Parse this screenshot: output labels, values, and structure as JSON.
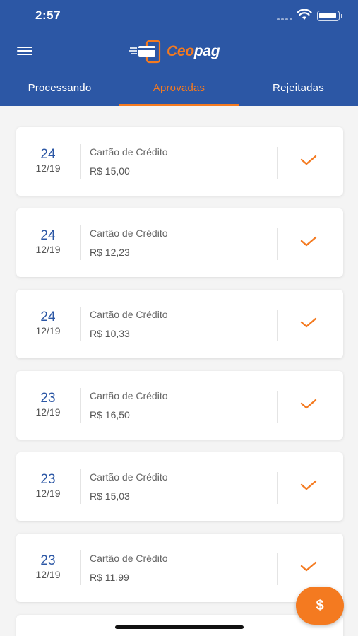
{
  "status_bar": {
    "time": "2:57"
  },
  "header": {
    "logo": {
      "part1": "Ceo",
      "part2": "pag"
    },
    "tabs": [
      {
        "label": "Processando",
        "active": false
      },
      {
        "label": "Aprovadas",
        "active": true
      },
      {
        "label": "Rejeitadas",
        "active": false
      }
    ]
  },
  "transactions": [
    {
      "day": "24",
      "month": "12/19",
      "method": "Cartão de Crédito",
      "amount": "R$ 15,00",
      "status_icon": "check-icon"
    },
    {
      "day": "24",
      "month": "12/19",
      "method": "Cartão de Crédito",
      "amount": "R$ 12,23",
      "status_icon": "check-icon"
    },
    {
      "day": "24",
      "month": "12/19",
      "method": "Cartão de Crédito",
      "amount": "R$ 10,33",
      "status_icon": "check-icon"
    },
    {
      "day": "23",
      "month": "12/19",
      "method": "Cartão de Crédito",
      "amount": "R$ 16,50",
      "status_icon": "check-icon"
    },
    {
      "day": "23",
      "month": "12/19",
      "method": "Cartão de Crédito",
      "amount": "R$ 15,03",
      "status_icon": "check-icon"
    },
    {
      "day": "23",
      "month": "12/19",
      "method": "Cartão de Crédito",
      "amount": "R$ 11,99",
      "status_icon": "check-icon"
    }
  ],
  "fab": {
    "label": "$",
    "icon": "dollar-icon"
  },
  "colors": {
    "primary": "#2c57a5",
    "accent": "#f47a20",
    "background": "#f4f4f4"
  }
}
